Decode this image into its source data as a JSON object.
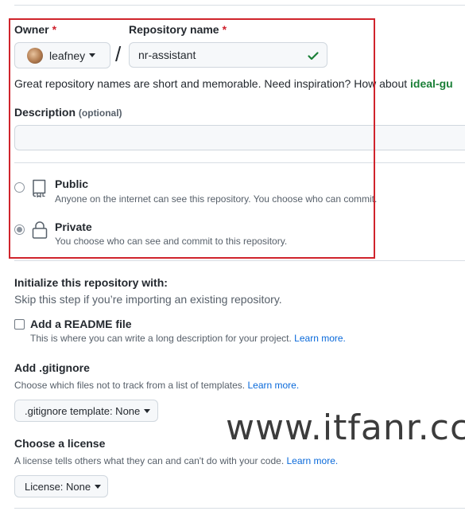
{
  "owner": {
    "label": "Owner",
    "required_mark": "*",
    "value": "leafney"
  },
  "repo_name": {
    "label": "Repository name",
    "required_mark": "*",
    "value": "nr-assistant",
    "separator": "/"
  },
  "name_hint": {
    "text": "Great repository names are short and memorable. Need inspiration? How about ",
    "suggestion": "ideal-gu"
  },
  "description": {
    "label": "Description",
    "optional": "(optional)",
    "value": ""
  },
  "visibility": {
    "selected": "private",
    "public": {
      "title": "Public",
      "desc": "Anyone on the internet can see this repository. You choose who can commit.",
      "icon": "repo-icon"
    },
    "private": {
      "title": "Private",
      "desc": "You choose who can see and commit to this repository.",
      "icon": "lock-icon"
    }
  },
  "init": {
    "title": "Initialize this repository with:",
    "subtitle": "Skip this step if you’re importing an existing repository.",
    "readme": {
      "label": "Add a README file",
      "desc": "This is where you can write a long description for your project.",
      "link": "Learn more.",
      "checked": false
    }
  },
  "gitignore": {
    "title": "Add .gitignore",
    "desc": "Choose which files not to track from a list of templates.",
    "link": "Learn more.",
    "button": ".gitignore template: None"
  },
  "license": {
    "title": "Choose a license",
    "desc": "A license tells others what they can and can't do with your code.",
    "link": "Learn more.",
    "button": "License: None"
  },
  "watermark": "www.itfanr.cc",
  "colors": {
    "link": "#0969da",
    "required": "#cf222e",
    "success": "#1a7f37",
    "annotation": "#d0242c"
  }
}
